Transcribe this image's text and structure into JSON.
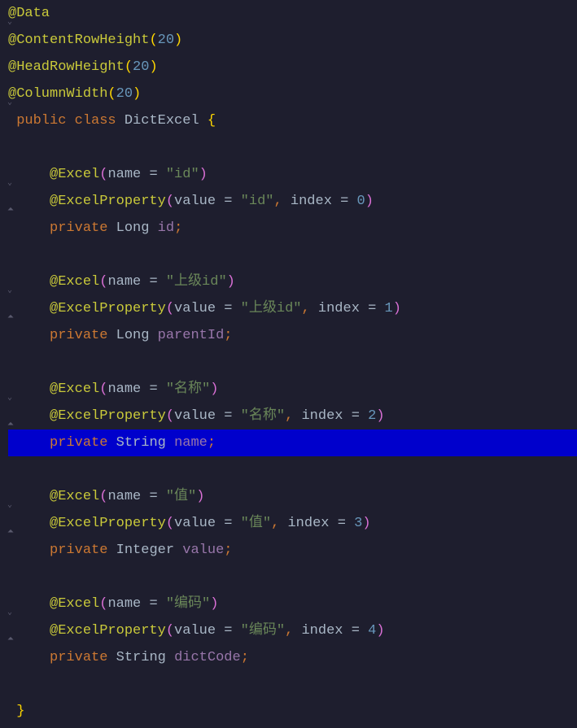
{
  "code": {
    "ann_data": "@Data",
    "ann_crh": "@ContentRowHeight",
    "ann_hrh": "@HeadRowHeight",
    "ann_cw": "@ColumnWidth",
    "crh_val": "20",
    "hrh_val": "20",
    "cw_val": "20",
    "kw_public": "public",
    "kw_class": "class",
    "classname": "DictExcel",
    "kw_private": "private",
    "ann_excel": "@Excel",
    "ann_excelprop": "@ExcelProperty",
    "param_name": "name",
    "param_value": "value",
    "param_index": "index",
    "type_long": "Long",
    "type_string": "String",
    "type_integer": "Integer",
    "fields": {
      "id": {
        "excel_name": "\"id\"",
        "prop_value": "\"id\"",
        "prop_index": "0",
        "type": "Long",
        "fieldname": "id"
      },
      "parentId": {
        "excel_name": "\"上级id\"",
        "prop_value": "\"上级id\"",
        "prop_index": "1",
        "type": "Long",
        "fieldname": "parentId"
      },
      "name": {
        "excel_name": "\"名称\"",
        "prop_value": "\"名称\"",
        "prop_index": "2",
        "type": "String",
        "fieldname": "name"
      },
      "value": {
        "excel_name": "\"值\"",
        "prop_value": "\"值\"",
        "prop_index": "3",
        "type": "Integer",
        "fieldname": "value"
      },
      "dictCode": {
        "excel_name": "\"编码\"",
        "prop_value": "\"编码\"",
        "prop_index": "4",
        "type": "String",
        "fieldname": "dictCode"
      }
    }
  }
}
